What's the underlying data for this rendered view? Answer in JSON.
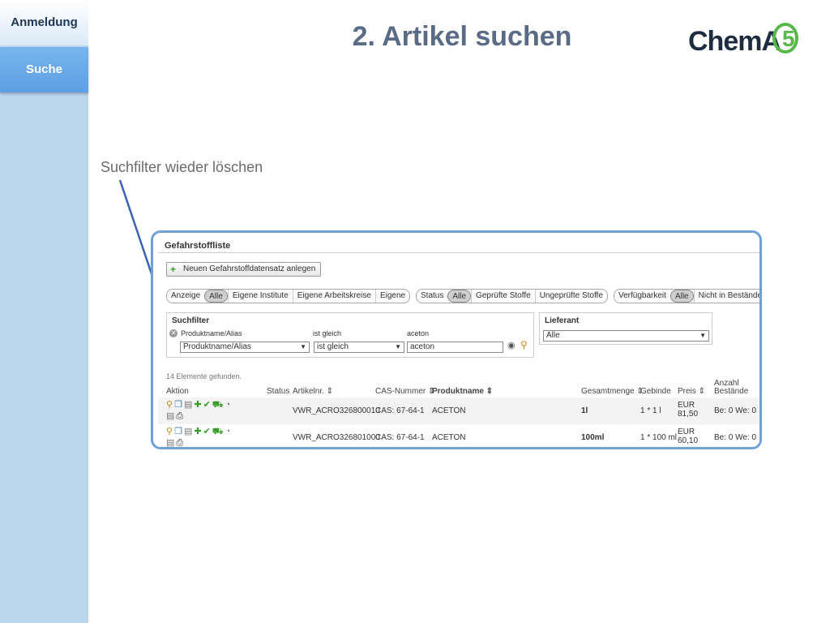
{
  "sidebar": {
    "items": [
      {
        "label": "Anmeldung"
      },
      {
        "label": "Suche"
      }
    ]
  },
  "header": {
    "title": "2. Artikel suchen",
    "logo": {
      "text": "ChemA",
      "number": "5"
    }
  },
  "annotation": {
    "text": "Suchfilter wieder löschen"
  },
  "panel": {
    "title": "Gefahrstoffliste",
    "new_button": "Neuen Gefahrstoffdatensatz anlegen",
    "filters": {
      "anzeige": [
        "Anzeige",
        "Alle",
        "Eigene Institute",
        "Eigene Arbeitskreise",
        "Eigene"
      ],
      "status": [
        "Status",
        "Alle",
        "Geprüfte Stoffe",
        "Ungeprüfte Stoffe"
      ],
      "verfuegbarkeit": [
        "Verfügbarkeit",
        "Alle",
        "Nicht in Beständen"
      ]
    },
    "suchfilter": {
      "title": "Suchfilter",
      "label_field": "Produktname/Alias",
      "label_op": "ist gleich",
      "label_value": "aceton",
      "field_value": "Produktname/Alias",
      "op_value": "ist gleich",
      "input_value": "aceton"
    },
    "lieferant": {
      "title": "Lieferant",
      "value": "Alle"
    },
    "result_count": "14 Elemente gefunden.",
    "columns": [
      "Aktion",
      "Status",
      "Artikelnr. ⇕",
      "CAS-Nummer ⇕",
      "Produktname ⇕",
      "Gesamtmenge ⇕",
      "Gebinde",
      "Preis ⇕",
      "Anzahl",
      "Bestände"
    ],
    "rows": [
      {
        "artikelnr": "VWR_ACRO326800010",
        "cas": "CAS: 67-64-1",
        "name": "ACETON",
        "menge": "1l",
        "gebinde": "1 * 1 l",
        "preis_cur": "EUR",
        "preis": "81,50",
        "bestaende": "Be: 0 We: 0"
      },
      {
        "artikelnr": "VWR_ACRO326801000",
        "cas": "CAS: 67-64-1",
        "name": "ACETON",
        "menge": "100ml",
        "gebinde": "1 * 100 ml",
        "preis_cur": "EUR",
        "preis": "60,10",
        "bestaende": "Be: 0 We: 0"
      }
    ]
  }
}
